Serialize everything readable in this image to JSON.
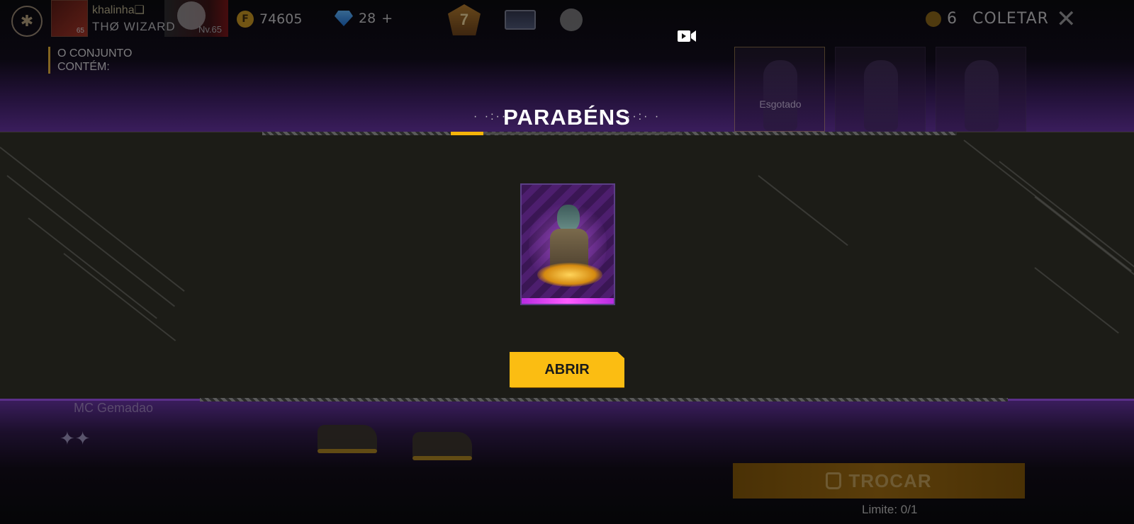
{
  "topbar": {
    "player_name": "khalinha❑",
    "player_level": "65",
    "guild_name": "THØ WIZARD",
    "guild_level": "Nv.65",
    "coins": "74605",
    "diamonds": "28",
    "diamond_add": "+",
    "rank_number": "7",
    "collect_count": "6",
    "collect_label": "COLETAR"
  },
  "background": {
    "set_label_line1": "O CONJUNTO",
    "set_label_line2": "CONTÉM:",
    "soldout_label": "Esgotado",
    "bottom_left_text": "MC Gemadao",
    "trade_button_label": "TROCAR",
    "limit_text": "Limite: 0/1"
  },
  "modal": {
    "title": "PARABÉNS",
    "dots_left": "· ·:··",
    "dots_right": "··:· ·",
    "open_button_label": "ABRIR"
  },
  "colors": {
    "accent_gold": "#fbbd12",
    "accent_purple": "#5b2f8a",
    "card_purple": "#4d1e6e",
    "card_magenta": "#ff5cff"
  },
  "icons": [
    "settings-icon",
    "coin-icon",
    "diamond-icon",
    "rank-badge-icon",
    "card-icon",
    "mystery-icon",
    "close-icon",
    "video-record-icon",
    "bag-icon",
    "stars-icon"
  ]
}
